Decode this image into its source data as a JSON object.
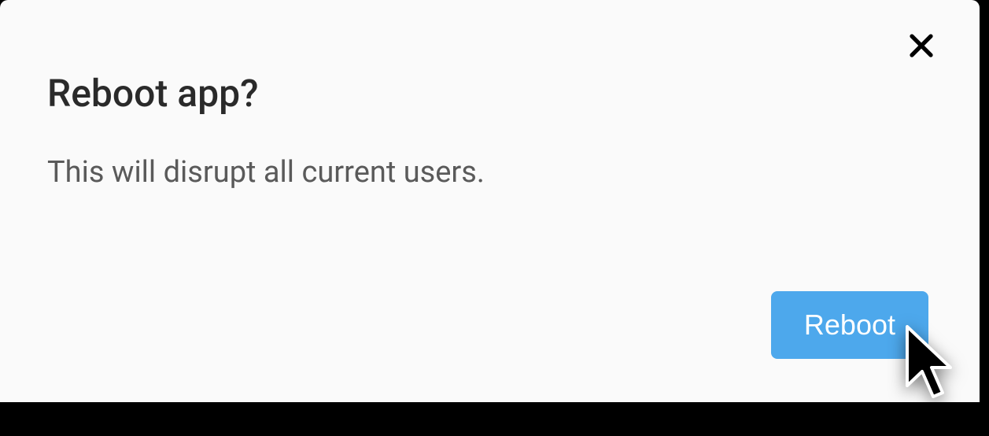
{
  "dialog": {
    "title": "Reboot app?",
    "body": "This will disrupt all current users.",
    "confirm_label": "Reboot"
  },
  "colors": {
    "accent": "#4da8ec",
    "background": "#fafafa"
  }
}
